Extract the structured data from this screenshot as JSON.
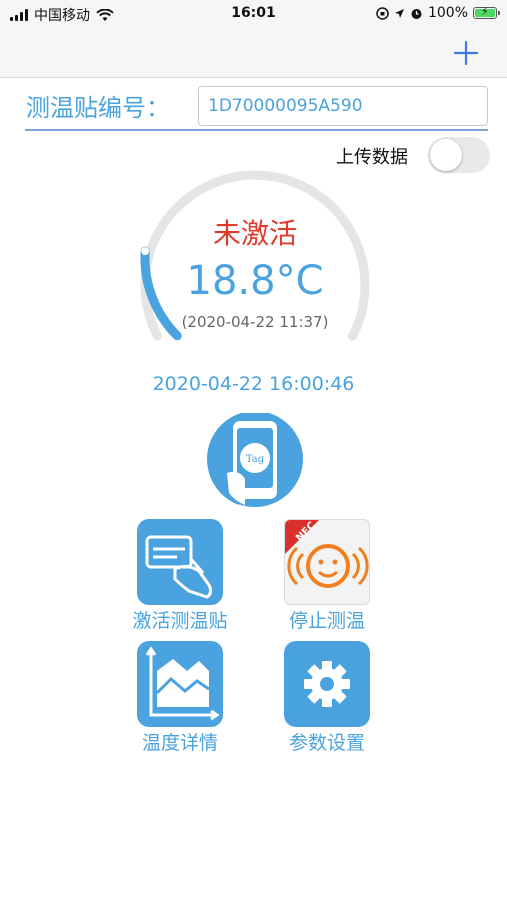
{
  "status_bar": {
    "carrier": "中国移动",
    "time": "16:01",
    "battery": "100%"
  },
  "nav": {
    "add_icon": "plus-icon"
  },
  "tag": {
    "label": "测温贴编号：",
    "value": "1D70000095A590"
  },
  "upload": {
    "label": "上传数据",
    "enabled": false
  },
  "gauge": {
    "status": "未激活",
    "temperature": "18.8°C",
    "reading_time": "(2020-04-22 11:37)",
    "level_fraction": 0.18
  },
  "current_time": "2020-04-22 16:00:46",
  "actions": [
    {
      "label": "激活测温贴",
      "icon": "card-hand-icon"
    },
    {
      "label": "停止测温",
      "icon": "nfc-stop-icon",
      "badge": "NFC"
    },
    {
      "label": "温度详情",
      "icon": "area-chart-icon"
    },
    {
      "label": "参数设置",
      "icon": "gear-icon"
    }
  ],
  "nfc_phone_icon": {
    "text": "Tag"
  },
  "colors": {
    "accent": "#4aa3df",
    "status_inactive": "#e03a2b",
    "nfc_orange": "#f07f1f"
  }
}
